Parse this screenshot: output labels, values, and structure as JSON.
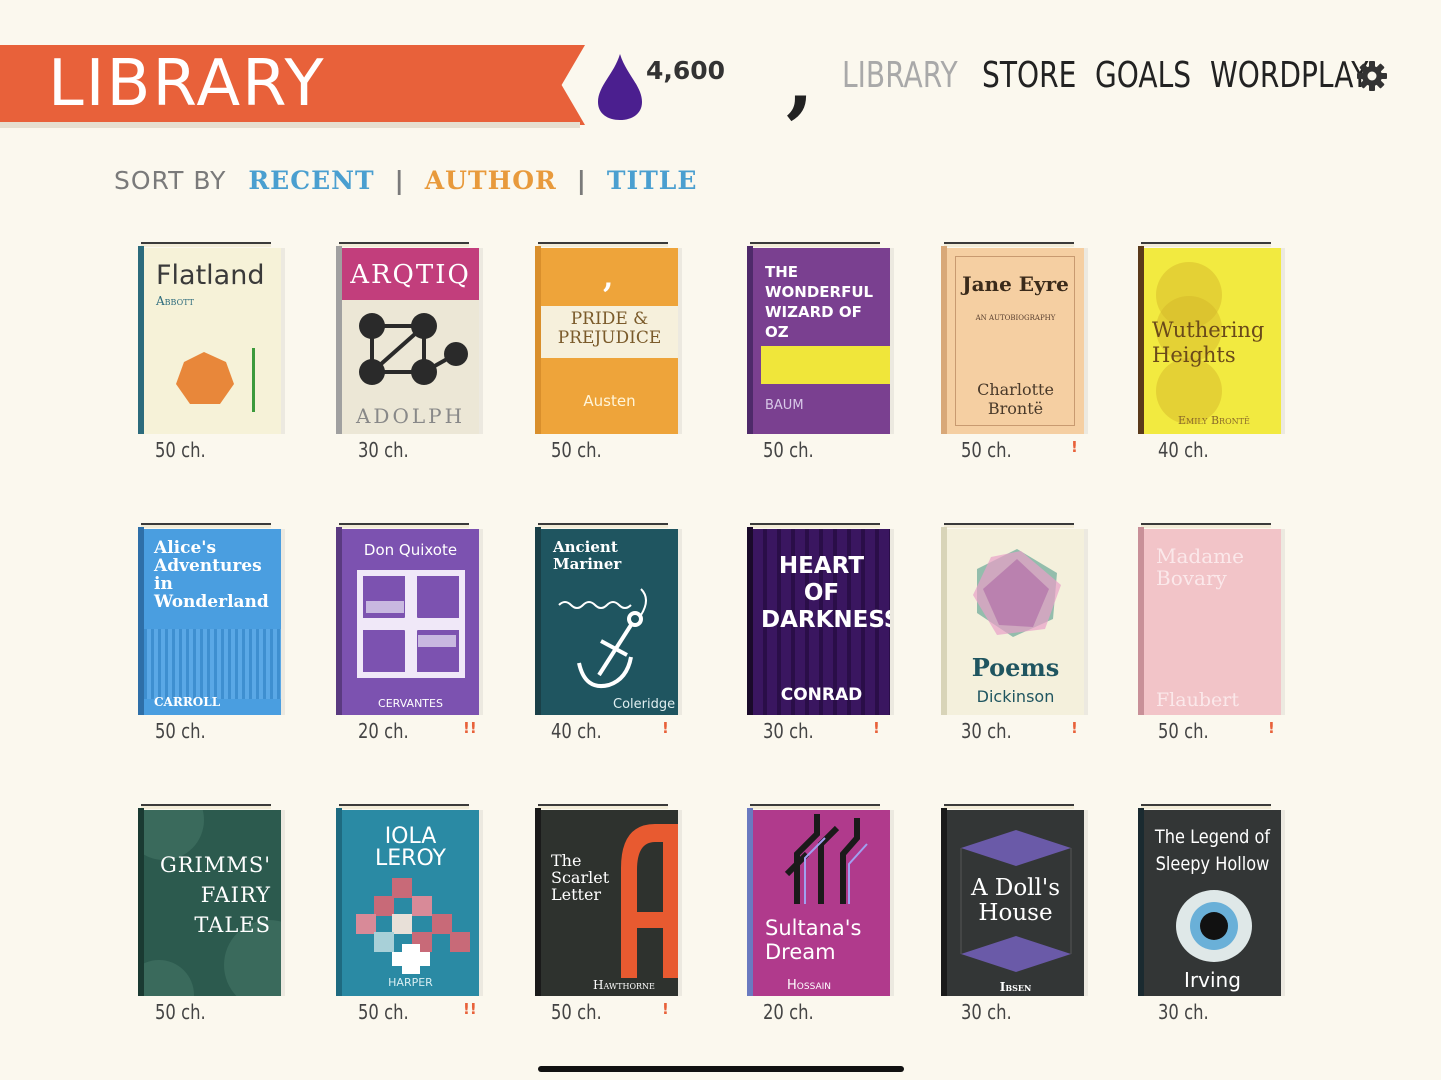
{
  "header": {
    "title": "LIBRARY",
    "ink_count": "4,600",
    "nav": [
      {
        "label": "LIBRARY",
        "active": true
      },
      {
        "label": "STORE",
        "active": false
      },
      {
        "label": "GOALS",
        "active": false
      },
      {
        "label": "WORDPLAY",
        "active": false
      }
    ]
  },
  "sort": {
    "label": "SORT BY",
    "options": [
      "RECENT",
      "AUTHOR",
      "TITLE"
    ],
    "colors": [
      "#4a9fd0",
      "#e89a3c",
      "#4a9fd0"
    ]
  },
  "books": [
    {
      "title": "Flatland",
      "author": "Abbott",
      "chapters": "50 ch.",
      "warning": ""
    },
    {
      "title": "ARQTIQ",
      "author": "ADOLPH",
      "chapters": "30 ch.",
      "warning": ""
    },
    {
      "title": "PRIDE & PREJUDICE",
      "author": "Austen",
      "chapters": "50 ch.",
      "warning": ""
    },
    {
      "title": "THE WONDERFUL WIZARD OF OZ",
      "author": "BAUM",
      "chapters": "50 ch.",
      "warning": ""
    },
    {
      "title": "Jane Eyre",
      "subtitle": "AN AUTOBIOGRAPHY",
      "author": "Charlotte Brontë",
      "chapters": "50 ch.",
      "warning": "!"
    },
    {
      "title": "Wuthering Heights",
      "author": "Emily Brontë",
      "chapters": "40 ch.",
      "warning": ""
    },
    {
      "title": "Alice's Adventures in Wonderland",
      "author": "CARROLL",
      "chapters": "50 ch.",
      "warning": ""
    },
    {
      "title": "Don Quixote",
      "author": "CERVANTES",
      "chapters": "20 ch.",
      "warning": "!!"
    },
    {
      "title": "Ancient Mariner",
      "author": "Coleridge",
      "chapters": "40 ch.",
      "warning": "!"
    },
    {
      "title": "HEART OF DARKNESS",
      "author": "CONRAD",
      "chapters": "30 ch.",
      "warning": "!"
    },
    {
      "title": "Poems",
      "author": "Dickinson",
      "chapters": "30 ch.",
      "warning": "!"
    },
    {
      "title": "Madame Bovary",
      "author": "Flaubert",
      "chapters": "50 ch.",
      "warning": "!"
    },
    {
      "title": "GRIMMS' FAIRY TALES",
      "author": "",
      "chapters": "50 ch.",
      "warning": ""
    },
    {
      "title": "IOLA LEROY",
      "author": "HARPER",
      "chapters": "50 ch.",
      "warning": "!!"
    },
    {
      "title": "The Scarlet Letter",
      "author": "Hawthorne",
      "chapters": "50 ch.",
      "warning": "!"
    },
    {
      "title": "Sultana's Dream",
      "author": "Hossain",
      "chapters": "20 ch.",
      "warning": ""
    },
    {
      "title": "A Doll's House",
      "author": "Ibsen",
      "chapters": "30 ch.",
      "warning": ""
    },
    {
      "title": "The Legend of Sleepy Hollow",
      "author": "Irving",
      "chapters": "30 ch.",
      "warning": ""
    }
  ],
  "colors": {
    "accent": "#e8613a",
    "ink": "#4b1f8f",
    "background": "#fbf8ee"
  }
}
